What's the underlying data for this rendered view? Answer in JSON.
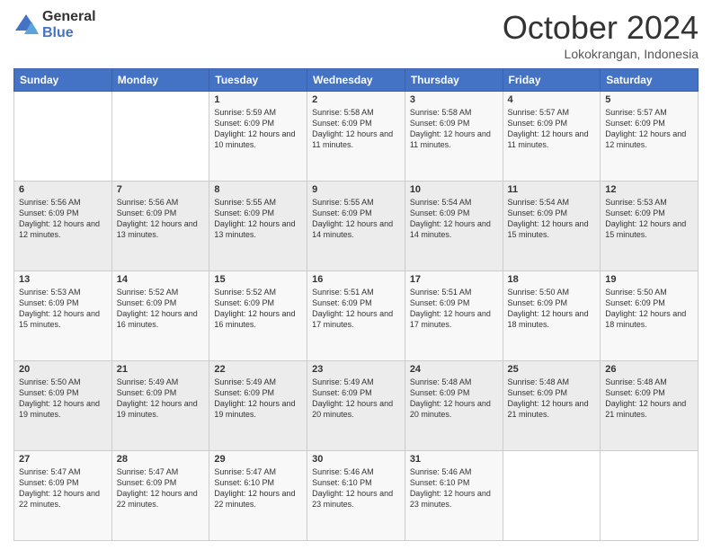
{
  "logo": {
    "general": "General",
    "blue": "Blue"
  },
  "header": {
    "month": "October 2024",
    "location": "Lokokrangan, Indonesia"
  },
  "weekdays": [
    "Sunday",
    "Monday",
    "Tuesday",
    "Wednesday",
    "Thursday",
    "Friday",
    "Saturday"
  ],
  "weeks": [
    [
      {
        "day": "",
        "info": ""
      },
      {
        "day": "",
        "info": ""
      },
      {
        "day": "1",
        "info": "Sunrise: 5:59 AM\nSunset: 6:09 PM\nDaylight: 12 hours and 10 minutes."
      },
      {
        "day": "2",
        "info": "Sunrise: 5:58 AM\nSunset: 6:09 PM\nDaylight: 12 hours and 11 minutes."
      },
      {
        "day": "3",
        "info": "Sunrise: 5:58 AM\nSunset: 6:09 PM\nDaylight: 12 hours and 11 minutes."
      },
      {
        "day": "4",
        "info": "Sunrise: 5:57 AM\nSunset: 6:09 PM\nDaylight: 12 hours and 11 minutes."
      },
      {
        "day": "5",
        "info": "Sunrise: 5:57 AM\nSunset: 6:09 PM\nDaylight: 12 hours and 12 minutes."
      }
    ],
    [
      {
        "day": "6",
        "info": "Sunrise: 5:56 AM\nSunset: 6:09 PM\nDaylight: 12 hours and 12 minutes."
      },
      {
        "day": "7",
        "info": "Sunrise: 5:56 AM\nSunset: 6:09 PM\nDaylight: 12 hours and 13 minutes."
      },
      {
        "day": "8",
        "info": "Sunrise: 5:55 AM\nSunset: 6:09 PM\nDaylight: 12 hours and 13 minutes."
      },
      {
        "day": "9",
        "info": "Sunrise: 5:55 AM\nSunset: 6:09 PM\nDaylight: 12 hours and 14 minutes."
      },
      {
        "day": "10",
        "info": "Sunrise: 5:54 AM\nSunset: 6:09 PM\nDaylight: 12 hours and 14 minutes."
      },
      {
        "day": "11",
        "info": "Sunrise: 5:54 AM\nSunset: 6:09 PM\nDaylight: 12 hours and 15 minutes."
      },
      {
        "day": "12",
        "info": "Sunrise: 5:53 AM\nSunset: 6:09 PM\nDaylight: 12 hours and 15 minutes."
      }
    ],
    [
      {
        "day": "13",
        "info": "Sunrise: 5:53 AM\nSunset: 6:09 PM\nDaylight: 12 hours and 15 minutes."
      },
      {
        "day": "14",
        "info": "Sunrise: 5:52 AM\nSunset: 6:09 PM\nDaylight: 12 hours and 16 minutes."
      },
      {
        "day": "15",
        "info": "Sunrise: 5:52 AM\nSunset: 6:09 PM\nDaylight: 12 hours and 16 minutes."
      },
      {
        "day": "16",
        "info": "Sunrise: 5:51 AM\nSunset: 6:09 PM\nDaylight: 12 hours and 17 minutes."
      },
      {
        "day": "17",
        "info": "Sunrise: 5:51 AM\nSunset: 6:09 PM\nDaylight: 12 hours and 17 minutes."
      },
      {
        "day": "18",
        "info": "Sunrise: 5:50 AM\nSunset: 6:09 PM\nDaylight: 12 hours and 18 minutes."
      },
      {
        "day": "19",
        "info": "Sunrise: 5:50 AM\nSunset: 6:09 PM\nDaylight: 12 hours and 18 minutes."
      }
    ],
    [
      {
        "day": "20",
        "info": "Sunrise: 5:50 AM\nSunset: 6:09 PM\nDaylight: 12 hours and 19 minutes."
      },
      {
        "day": "21",
        "info": "Sunrise: 5:49 AM\nSunset: 6:09 PM\nDaylight: 12 hours and 19 minutes."
      },
      {
        "day": "22",
        "info": "Sunrise: 5:49 AM\nSunset: 6:09 PM\nDaylight: 12 hours and 19 minutes."
      },
      {
        "day": "23",
        "info": "Sunrise: 5:49 AM\nSunset: 6:09 PM\nDaylight: 12 hours and 20 minutes."
      },
      {
        "day": "24",
        "info": "Sunrise: 5:48 AM\nSunset: 6:09 PM\nDaylight: 12 hours and 20 minutes."
      },
      {
        "day": "25",
        "info": "Sunrise: 5:48 AM\nSunset: 6:09 PM\nDaylight: 12 hours and 21 minutes."
      },
      {
        "day": "26",
        "info": "Sunrise: 5:48 AM\nSunset: 6:09 PM\nDaylight: 12 hours and 21 minutes."
      }
    ],
    [
      {
        "day": "27",
        "info": "Sunrise: 5:47 AM\nSunset: 6:09 PM\nDaylight: 12 hours and 22 minutes."
      },
      {
        "day": "28",
        "info": "Sunrise: 5:47 AM\nSunset: 6:09 PM\nDaylight: 12 hours and 22 minutes."
      },
      {
        "day": "29",
        "info": "Sunrise: 5:47 AM\nSunset: 6:10 PM\nDaylight: 12 hours and 22 minutes."
      },
      {
        "day": "30",
        "info": "Sunrise: 5:46 AM\nSunset: 6:10 PM\nDaylight: 12 hours and 23 minutes."
      },
      {
        "day": "31",
        "info": "Sunrise: 5:46 AM\nSunset: 6:10 PM\nDaylight: 12 hours and 23 minutes."
      },
      {
        "day": "",
        "info": ""
      },
      {
        "day": "",
        "info": ""
      }
    ]
  ]
}
